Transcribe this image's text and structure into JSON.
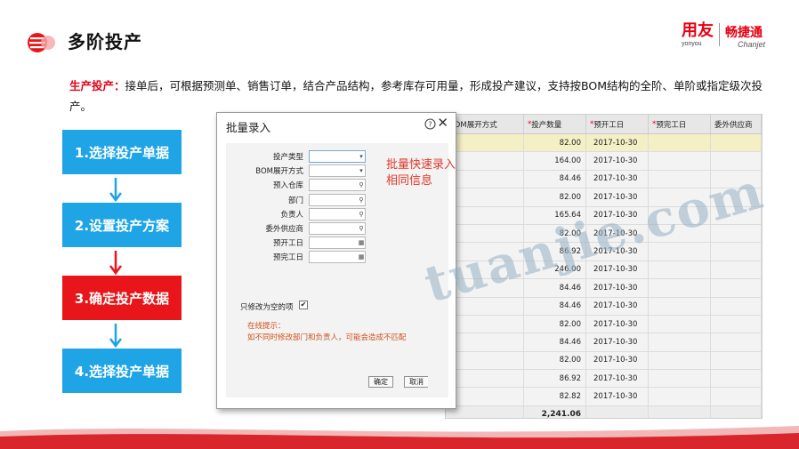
{
  "slide": {
    "title": "多阶投产",
    "brand": {
      "yonyou": "用友",
      "yonyou_sub": "yonyou",
      "chanjet": "畅捷通",
      "chanjet_sub": "Chanjet"
    },
    "desc_lead": "生产投产：",
    "desc_body": "接单后，可根据预测单、销售订单，结合产品结构，参考库存可用量，形成投产建议，支持按BOM结构的全阶、单阶或指定级次投产。"
  },
  "steps": [
    {
      "label": "1.选择投产单据",
      "color": "#1fa4e6"
    },
    {
      "label": "2.设置投产方案",
      "color": "#1fa4e6"
    },
    {
      "label": "3.确定投产数据",
      "color": "#e8161b"
    },
    {
      "label": "4.选择投产单据",
      "color": "#1fa4e6"
    }
  ],
  "grid": {
    "headers": [
      "BOM展开方式",
      "投产数量",
      "预开工日",
      "预完工日",
      "委外供应商"
    ],
    "required": [
      "",
      "*",
      "*",
      "*",
      ""
    ],
    "rows": [
      {
        "qty": "82.00",
        "date": "2017-10-30"
      },
      {
        "qty": "164.00",
        "date": "2017-10-30"
      },
      {
        "qty": "84.46",
        "date": "2017-10-30"
      },
      {
        "qty": "82.00",
        "date": "2017-10-30"
      },
      {
        "qty": "165.64",
        "date": "2017-10-30"
      },
      {
        "qty": "82.00",
        "date": "2017-10-30"
      },
      {
        "qty": "86.92",
        "date": "2017-10-30"
      },
      {
        "qty": "246.00",
        "date": "2017-10-30"
      },
      {
        "qty": "84.46",
        "date": "2017-10-30"
      },
      {
        "qty": "84.46",
        "date": "2017-10-30"
      },
      {
        "qty": "82.00",
        "date": "2017-10-30"
      },
      {
        "qty": "84.46",
        "date": "2017-10-30"
      },
      {
        "qty": "82.00",
        "date": "2017-10-30"
      },
      {
        "qty": "86.92",
        "date": "2017-10-30"
      },
      {
        "qty": "82.82",
        "date": "2017-10-30"
      }
    ],
    "total": "2,241.06"
  },
  "dialog": {
    "title": "批量录入",
    "fields": [
      {
        "label": "投产类型",
        "control": "select"
      },
      {
        "label": "BOM展开方式",
        "control": "select"
      },
      {
        "label": "预入仓库",
        "control": "search"
      },
      {
        "label": "部门",
        "control": "search"
      },
      {
        "label": "负责人",
        "control": "search"
      },
      {
        "label": "委外供应商",
        "control": "search"
      },
      {
        "label": "预开工日",
        "control": "date"
      },
      {
        "label": "预完工日",
        "control": "date"
      }
    ],
    "hint": "批量快速录入相同信息",
    "only_empty_label": "只修改为空的项",
    "only_empty_checked": true,
    "tip_title": "在线提示：",
    "tip_text": "如不同时修改部门和负责人，可能会造成不匹配",
    "ok_label": "确定",
    "cancel_label": "取消"
  },
  "watermark": "tuanjie.com",
  "colors": {
    "accent_red": "#e60012",
    "step_blue": "#1fa4e6",
    "step_red": "#e8161b"
  }
}
